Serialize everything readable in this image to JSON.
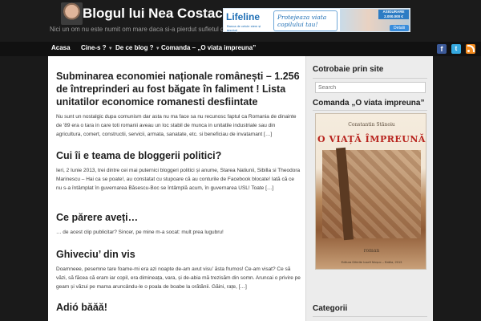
{
  "header": {
    "site_title": "Blogul lui Nea Costache",
    "tagline": "Nici un om nu este numit om mare daca si-a pierdut sufletul de copil!",
    "banner": {
      "logo": "Lifeline",
      "logo_sub": "Banca de celule stem și țesuturi",
      "slogan": "Protejeaza viata copilului tau!",
      "badge": "ASIGURARE 2.000.000 €",
      "button": "Detalii"
    }
  },
  "nav": {
    "items": [
      {
        "label": "Acasa",
        "has_dropdown": false
      },
      {
        "label": "Cine-s ?",
        "has_dropdown": true
      },
      {
        "label": "De ce blog ?",
        "has_dropdown": true
      },
      {
        "label": "Comanda – „O viata impreuna”",
        "has_dropdown": false
      }
    ],
    "social": {
      "facebook": "f",
      "twitter": "t",
      "rss": "rss-icon"
    }
  },
  "posts": [
    {
      "title": "Subminarea economiei naționale românești – 1.256 de întreprinderi au fost băgate în faliment ! Lista unitatilor economice romanesti desfiintate",
      "excerpt": "Nu sunt un nostalgic dupa comunism dar asta nu ma face sa nu recunosc faptul ca Romania de dinainte de '89 era o tara in care toti romanii aveau un loc stabil de munca in unitatile industriale sau din agricultura, comert, constructii, servicii, armata, sanatate, etc. si beneficiau de invatamant […]"
    },
    {
      "title": "Cui îi e teama de bloggerii politici?",
      "excerpt": "Ieri, 2 Iunie 2013, trei dintre cei mai puternici bloggeri politici și anume, Starea Natiunii, Sibilla si Theodora Marinescu – Hai ca se poate!, au constatat cu stupoare că au conturile de Facebook blocate! Iată că ce nu s-a întâmplat în guvernarea Băsescu-Boc se întâmplă acum, în guvernarea USL! Toate […]"
    },
    {
      "title": "Ce părere aveți…",
      "excerpt": "… de acest clip publicitar? Sincer,  pe mine m-a socat: mult prea lugubru!"
    },
    {
      "title": "Ghiveciu’ din vis",
      "excerpt": "Doamneee, pesemne tare foame-mi era azi noapte de-am avut visu’ ăsta frumos! Ce-am visat? Ce să văzi, să făcea că eram iar copil, era dimineața, vara, și de-abia mă trezisăm din somn. Aruncai o privire pe geam și văzui pe mama aruncându-le o poala de boabe la orătănii. Găini, rațe, […]"
    },
    {
      "title": "Adió băăă!",
      "excerpt": ""
    }
  ],
  "sidebar": {
    "search_title": "Cotrobaie prin site",
    "search_placeholder": "Search",
    "order_title": "Comanda „O viata impreuna”",
    "book": {
      "author": "Constantin Stănoiu",
      "title": "O VIAȚĂ ÎMPREUNĂ",
      "genre": "roman",
      "publisher": "Editura Diferite Iosefi Moșoc – Brăila, 2013"
    },
    "categories_title": "Categorii"
  },
  "colors": {
    "header_bg": "#1b1b1b",
    "nav_bg": "#111111",
    "content_bg": "#ffffff",
    "sidebar_bg": "#ececec",
    "book_title": "#b8241e"
  }
}
